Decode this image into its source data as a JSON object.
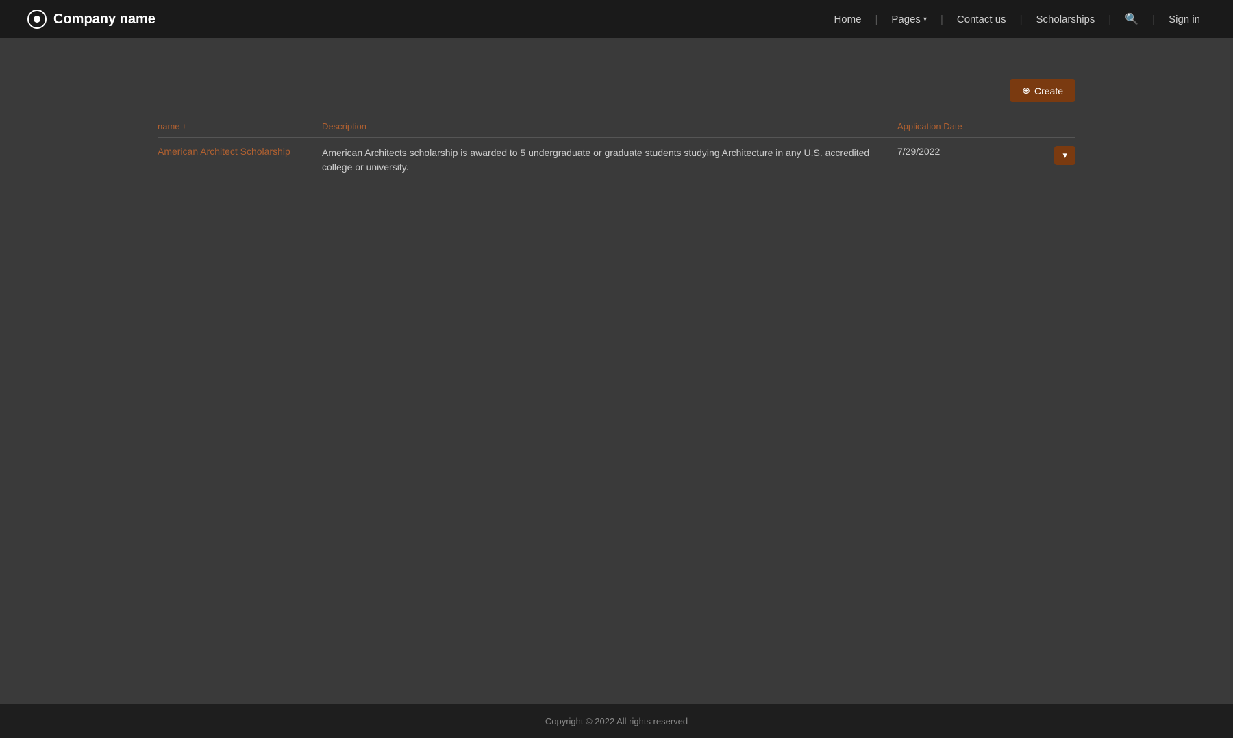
{
  "brand": {
    "name": "Company name"
  },
  "nav": {
    "home": "Home",
    "pages": "Pages",
    "contact": "Contact us",
    "scholarships": "Scholarships",
    "signin": "Sign in"
  },
  "toolbar": {
    "create_label": "Create"
  },
  "table": {
    "columns": [
      {
        "key": "name",
        "label": "name",
        "sort": true
      },
      {
        "key": "description",
        "label": "Description",
        "sort": false
      },
      {
        "key": "applicationDate",
        "label": "Application Date",
        "sort": true
      }
    ],
    "rows": [
      {
        "name": "American Architect Scholarship",
        "description": "American Architects scholarship is awarded to 5 undergraduate or graduate students studying Architecture in any U.S. accredited college or university.",
        "applicationDate": "7/29/2022"
      }
    ]
  },
  "footer": {
    "copyright": "Copyright © 2022  All rights reserved"
  }
}
